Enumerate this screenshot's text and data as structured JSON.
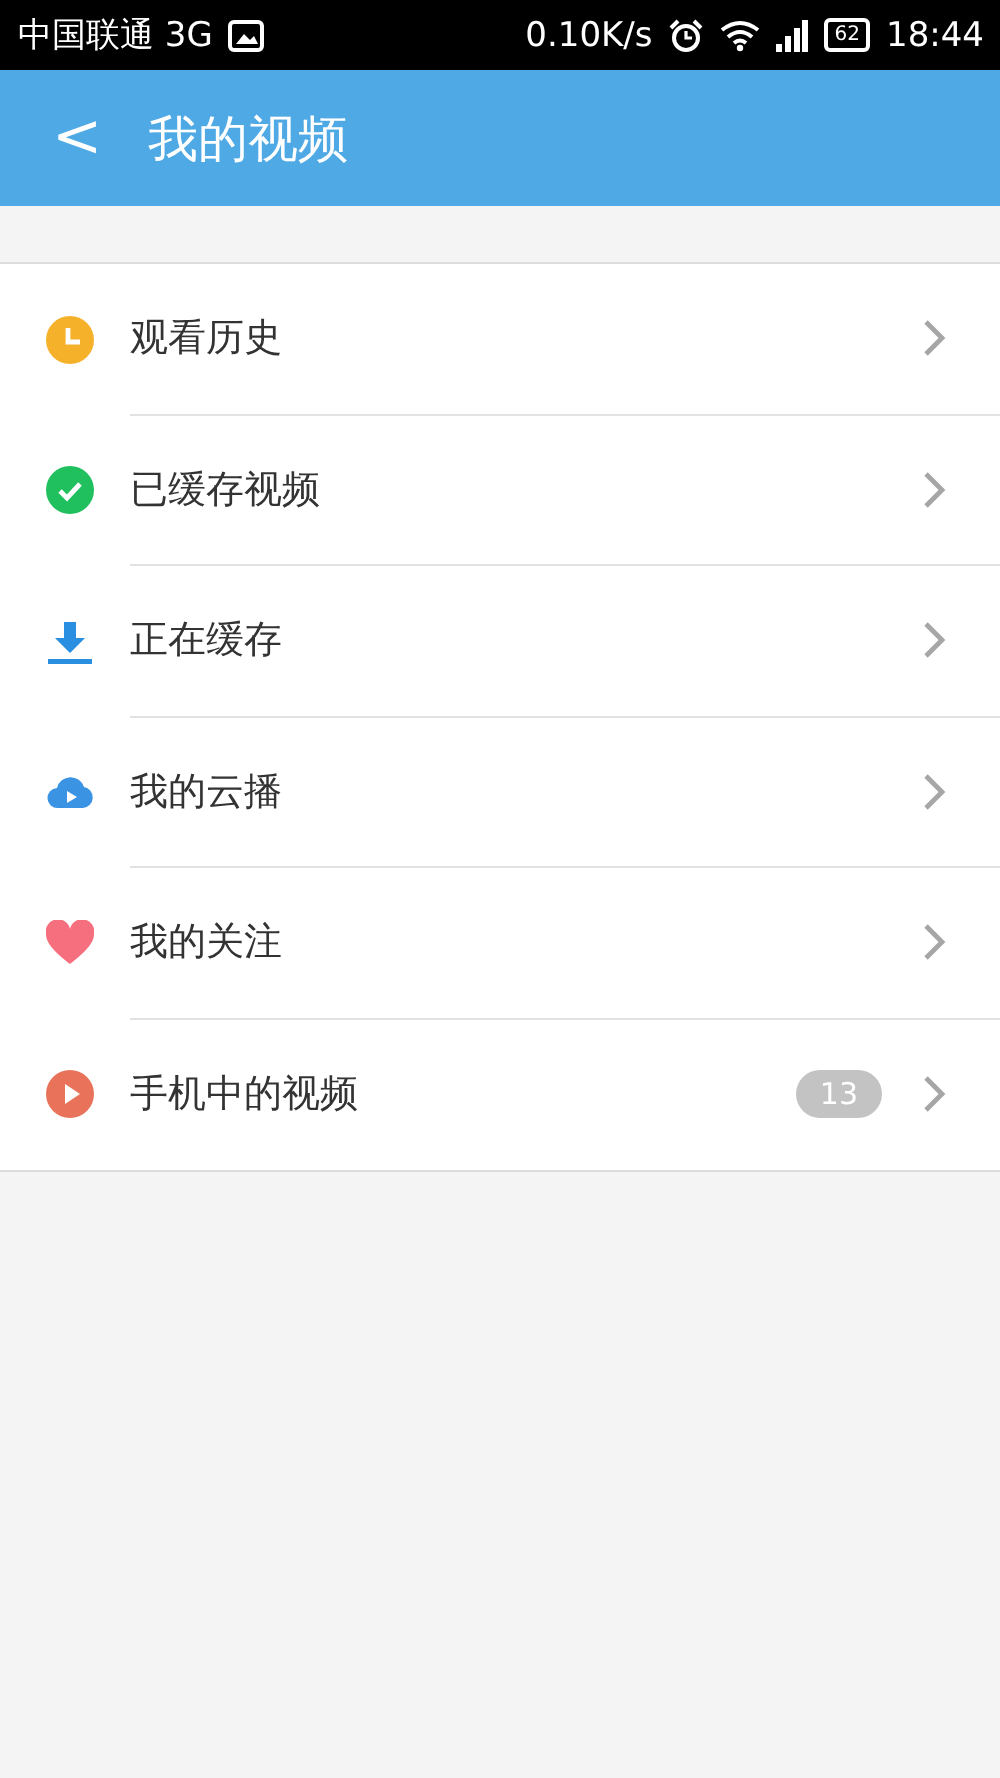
{
  "status_bar": {
    "carrier": "中国联通 3G",
    "speed": "0.10K/s",
    "battery": "62",
    "time": "18:44"
  },
  "header": {
    "back": "<",
    "title": "我的视频"
  },
  "items": [
    {
      "kind": "history",
      "label": "观看历史"
    },
    {
      "kind": "cached",
      "label": "已缓存视频"
    },
    {
      "kind": "downloading",
      "label": "正在缓存"
    },
    {
      "kind": "cloud",
      "label": "我的云播"
    },
    {
      "kind": "favorite",
      "label": "我的关注"
    },
    {
      "kind": "local",
      "label": "手机中的视频",
      "badge": "13"
    }
  ]
}
